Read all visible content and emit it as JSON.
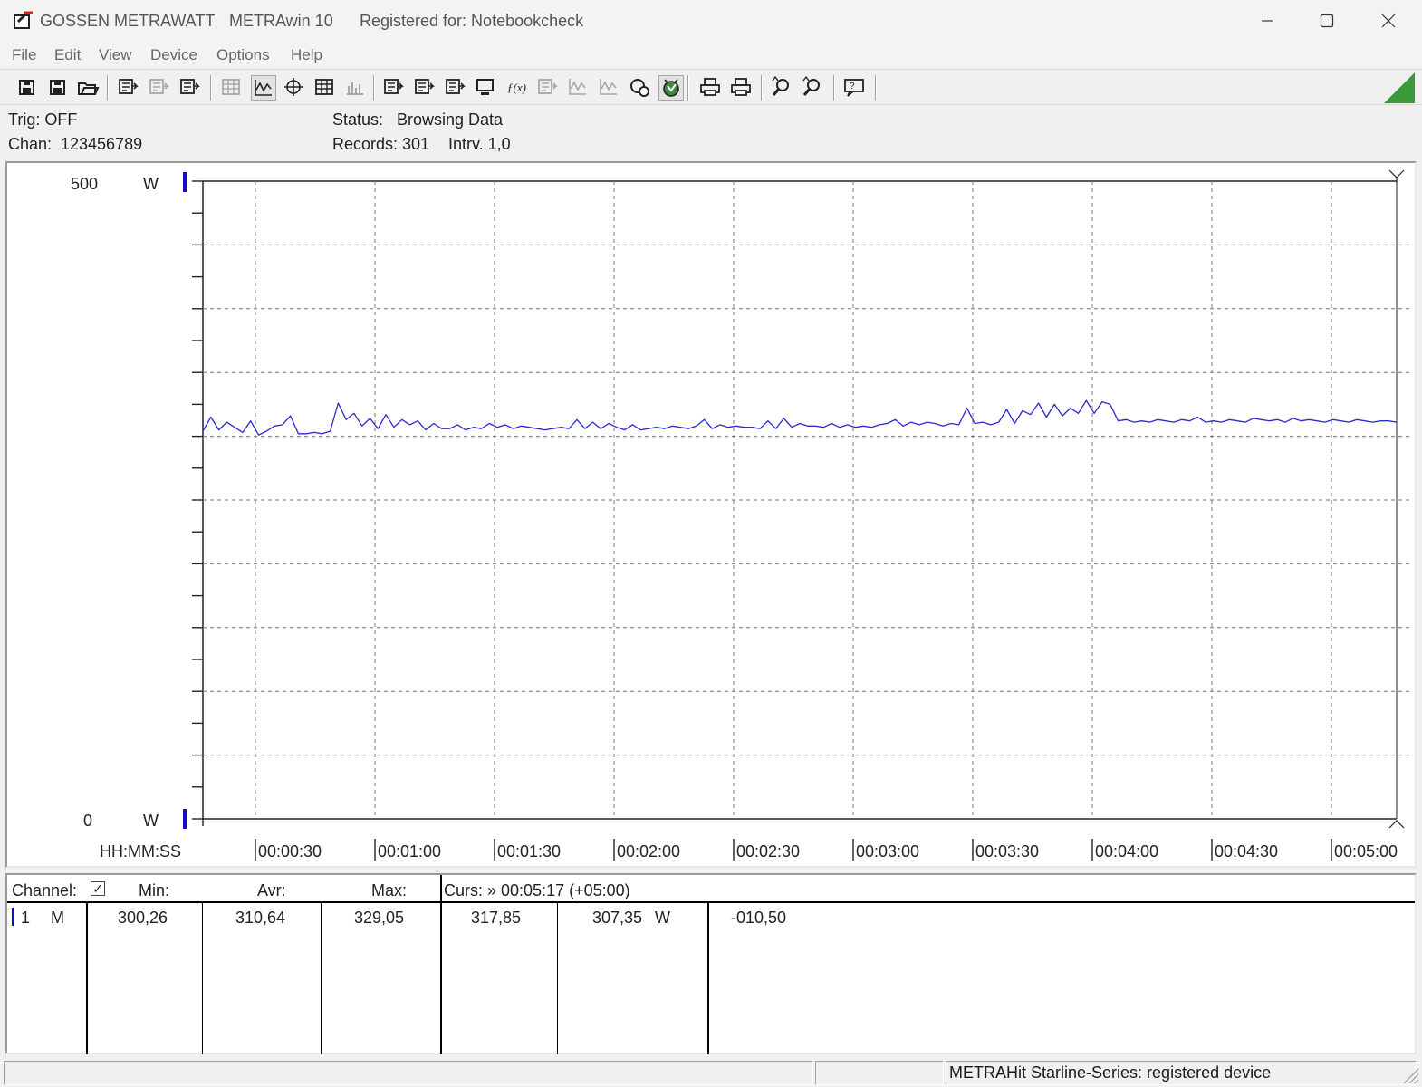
{
  "window": {
    "brand": "GOSSEN METRAWATT",
    "app_title": "METRAwin 10",
    "registered": "Registered for: Notebookcheck"
  },
  "menu": [
    "File",
    "Edit",
    "View",
    "Device",
    "Options",
    "Help"
  ],
  "toolbar": {
    "icons": [
      "save-icon",
      "save-as-icon",
      "open-folder-icon",
      "export-icon",
      "import-icon",
      "transfer-icon",
      "list-icon",
      "yt-graph-icon",
      "xy-graph-icon",
      "table-icon",
      "histogram-icon",
      "device-settings-icon",
      "channel-settings-icon",
      "record-settings-icon",
      "computer-icon",
      "formula-icon",
      "monitor-icon",
      "waveform-icon",
      "spectrum-icon",
      "trigger-icon",
      "start-icon",
      "print-icon",
      "print-setup-icon",
      "zoom-in-icon",
      "zoom-out-icon",
      "help-icon"
    ]
  },
  "info": {
    "trig": "Trig: OFF",
    "chan_label": "Chan:",
    "chan_value": "123456789",
    "status_label": "Status:",
    "status_value": "Browsing Data",
    "records": "Records: 301",
    "interval": "Intrv. 1,0"
  },
  "chart_data": {
    "type": "line",
    "ylim": [
      0,
      500
    ],
    "y_top_label": "500",
    "y_bottom_label": "0",
    "unit": "W",
    "xlabel": "HH:MM:SS",
    "x_ticks": [
      "00:00:30",
      "00:01:00",
      "00:01:30",
      "00:02:00",
      "00:02:30",
      "00:03:00",
      "00:03:30",
      "00:04:00",
      "00:04:30",
      "00:05:00"
    ],
    "x_tick_seconds": [
      30,
      60,
      90,
      120,
      150,
      180,
      210,
      240,
      270,
      300
    ],
    "xlim_seconds": [
      0,
      300
    ],
    "grid": true,
    "series": [
      {
        "color": "#2a2acd",
        "x": [
          0,
          2,
          4,
          6,
          8,
          10,
          12,
          14,
          16,
          18,
          20,
          22,
          24,
          26,
          28,
          30,
          32,
          34,
          36,
          38,
          40,
          42,
          44,
          46,
          48,
          50,
          52,
          54,
          56,
          58,
          60,
          62,
          64,
          66,
          68,
          70,
          72,
          74,
          76,
          78,
          80,
          82,
          84,
          86,
          88,
          90,
          92,
          94,
          96,
          98,
          100,
          102,
          104,
          106,
          108,
          110,
          112,
          114,
          116,
          118,
          120,
          122,
          124,
          126,
          128,
          130,
          132,
          134,
          136,
          138,
          140,
          142,
          144,
          146,
          148,
          150,
          152,
          154,
          156,
          158,
          160,
          162,
          164,
          166,
          168,
          170,
          172,
          174,
          176,
          178,
          180,
          182,
          184,
          186,
          188,
          190,
          192,
          194,
          196,
          198,
          200,
          202,
          204,
          206,
          208,
          210,
          212,
          214,
          216,
          218,
          220,
          222,
          224,
          226,
          228,
          230,
          232,
          234,
          236,
          238,
          240,
          242,
          244,
          246,
          248,
          250,
          252,
          254,
          256,
          258,
          260,
          262,
          264,
          266,
          268,
          270,
          272,
          274,
          276,
          278,
          280,
          282,
          284,
          286,
          288,
          290,
          292,
          294,
          296,
          298,
          300
        ],
        "values": [
          304,
          315,
          305,
          311,
          307,
          303,
          312,
          301,
          304,
          308,
          309,
          316,
          302,
          302,
          303,
          302,
          304,
          326,
          313,
          318,
          308,
          314,
          306,
          317,
          307,
          313,
          309,
          312,
          305,
          310,
          306,
          306,
          309,
          305,
          307,
          306,
          310,
          307,
          309,
          306,
          308,
          307,
          306,
          305,
          306,
          307,
          306,
          313,
          306,
          311,
          306,
          310,
          307,
          305,
          309,
          305,
          306,
          307,
          306,
          308,
          307,
          306,
          308,
          313,
          306,
          309,
          307,
          308,
          307,
          307,
          306,
          312,
          306,
          314,
          307,
          310,
          308,
          308,
          307,
          310,
          307,
          309,
          307,
          308,
          307,
          309,
          310,
          313,
          308,
          311,
          309,
          311,
          310,
          308,
          310,
          309,
          322,
          310,
          311,
          309,
          311,
          321,
          310,
          320,
          317,
          326,
          315,
          325,
          316,
          322,
          318,
          328,
          318,
          327,
          325,
          312,
          313,
          311,
          312,
          311,
          313,
          312,
          311,
          313,
          312,
          315,
          311,
          312,
          311,
          313,
          312,
          311,
          314,
          313,
          312,
          313,
          311,
          314,
          312,
          313,
          312,
          311,
          313,
          312,
          311,
          313,
          312,
          311,
          312,
          312,
          311
        ],
        "min": 300.26,
        "avg": 310.64,
        "max": 329.05
      }
    ]
  },
  "table": {
    "header": {
      "channel": "Channel:",
      "min": "Min:",
      "avr": "Avr:",
      "max": "Max:",
      "curs": "Curs: » 00:05:17 (+05:00)"
    },
    "rows": [
      {
        "num": "1",
        "mode": "M",
        "min": "300,26",
        "avr": "310,64",
        "max": "329,05",
        "curs1": "317,85",
        "curs2": "307,35",
        "unit": "W",
        "diff": "-010,50"
      }
    ]
  },
  "statusbar": {
    "device": "METRAHit Starline-Series: registered device"
  },
  "colors": {
    "series": "#2a2acd",
    "channel_marker": "#1010c0",
    "corner_triangle": "#3a9a3a"
  }
}
